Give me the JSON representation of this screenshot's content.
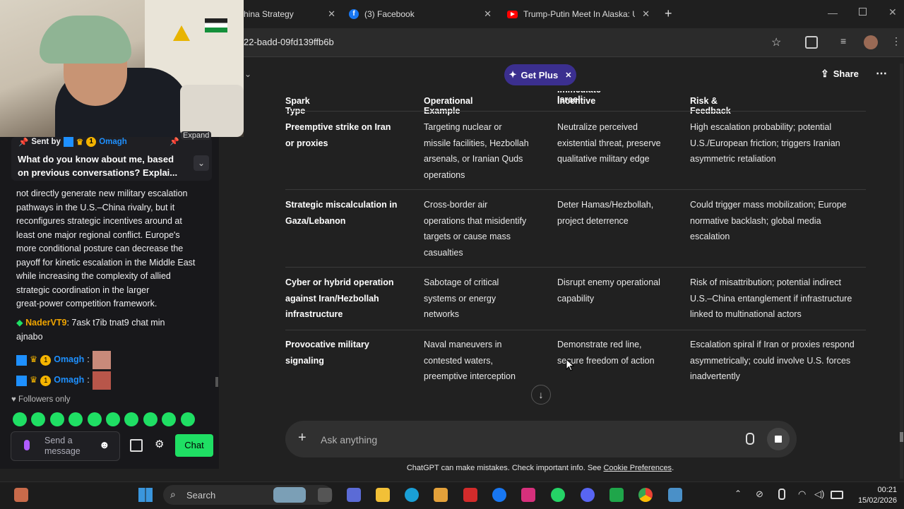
{
  "browser": {
    "tabs": [
      {
        "title": "hina Strategy",
        "icon": "chatgpt-icon"
      },
      {
        "title": "(3) Facebook",
        "icon": "facebook-icon"
      },
      {
        "title": "Trump-Putin Meet In Alaska: US",
        "icon": "youtube-icon"
      }
    ],
    "new_tab": "+",
    "url": "22-badd-09fd139ffb6b"
  },
  "header": {
    "get_plus": "Get Plus",
    "share": "Share"
  },
  "table": {
    "headers": [
      "Spark Type",
      "Operational Example",
      "Immediate Israeli",
      "Incentive",
      "Risk & Feedback"
    ],
    "rows": [
      {
        "spark": [
          "Preemptive strike on Iran",
          "or proxies"
        ],
        "example": [
          "Targeting nuclear or",
          "missile facilities, Hezbollah",
          "arsenals, or Iranian Quds",
          "operations"
        ],
        "incentive": [
          "Neutralize perceived",
          "existential threat, preserve",
          "qualitative military edge"
        ],
        "risk": [
          "High escalation probability; potential",
          "U.S./European friction; triggers Iranian",
          "asymmetric retaliation"
        ]
      },
      {
        "spark": [
          "Strategic miscalculation in",
          "Gaza/Lebanon"
        ],
        "example": [
          "Cross-border air",
          "operations that misidentify",
          "targets or cause mass",
          "casualties"
        ],
        "incentive": [
          "Deter Hamas/Hezbollah,",
          "project deterrence"
        ],
        "risk": [
          "Could trigger mass mobilization; Europe",
          "normative backlash; global media",
          "escalation"
        ]
      },
      {
        "spark": [
          "Cyber or hybrid operation",
          "against Iran/Hezbollah",
          "infrastructure"
        ],
        "example": [
          "Sabotage of critical",
          "systems or energy",
          "networks"
        ],
        "incentive": [
          "Disrupt enemy operational",
          "capability"
        ],
        "risk": [
          "Risk of misattribution; potential indirect",
          "U.S.–China entanglement if infrastructure",
          "linked to multinational actors"
        ]
      },
      {
        "spark": [
          "Provocative military",
          "signaling"
        ],
        "example": [
          "Naval maneuvers in",
          "contested waters,",
          "preemptive interception"
        ],
        "incentive": [
          "Demonstrate red line,",
          "secure freedom of action"
        ],
        "risk": [
          "Escalation spiral if Iran or proxies respond",
          "asymmetrically; could involve U.S. forces",
          "inadvertently"
        ]
      }
    ]
  },
  "composer": {
    "placeholder": "Ask anything",
    "footer": "ChatGPT can make mistakes. Check important info. See ",
    "footer_link": "Cookie Preferences",
    "footer_end": "."
  },
  "stream": {
    "pinned_sent_by": "Sent by",
    "pinned_user": "Omagh",
    "expand": "Expand",
    "pinned_message": "What do you know about me, based on previous conversations? Explai...",
    "bot_message": [
      "not directly generate new military escalation",
      "pathways in the U.S.–China rivalry, but it",
      "reconfigures strategic incentives around at",
      "least one major regional conflict. Europe's",
      "more conditional posture can decrease the",
      "payoff for kinetic escalation in the Middle East",
      "while increasing the complexity of allied",
      "strategic coordination in the larger",
      "great-power competition framework."
    ],
    "messages": [
      {
        "user": "NaderVT9",
        "text": ": 7ask t7ib tnat9 chat min",
        "text2": "ajnabo",
        "color": "#f0a500"
      },
      {
        "user": "Omagh",
        "text": ":",
        "color": "#1e90ff"
      },
      {
        "user": "Omagh",
        "text": ":",
        "color": "#1e90ff"
      }
    ],
    "badge_number": "1",
    "followers_only": "Followers only",
    "send_placeholder_1": "Send a",
    "send_placeholder_2": "message",
    "chat_button": "Chat"
  },
  "taskbar": {
    "search": "Search",
    "time": "00:21",
    "date": "15/02/2026"
  }
}
